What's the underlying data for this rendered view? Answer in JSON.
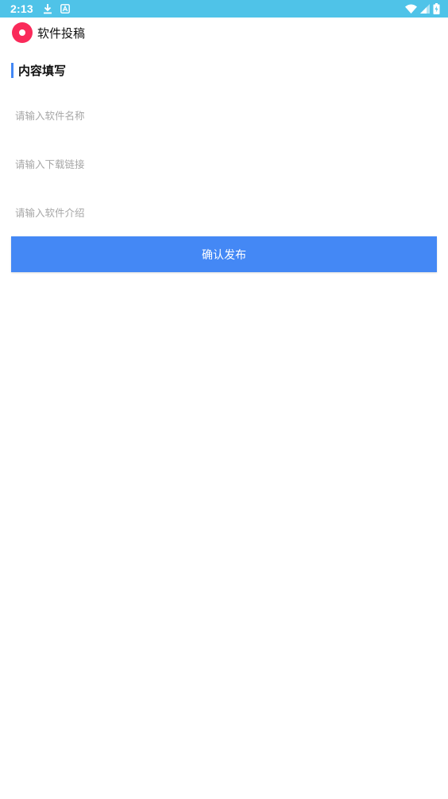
{
  "status_bar": {
    "time": "2:13",
    "left_icons": [
      "download-icon",
      "app-store-icon"
    ],
    "right_icons": [
      "wifi-icon",
      "signal-icon",
      "battery-charging-icon"
    ],
    "background_color": "#4fc3e8"
  },
  "header": {
    "title": "软件投稿",
    "logo_color": "#fa2a5a"
  },
  "section": {
    "title": "内容填写",
    "accent_color": "#4287f5"
  },
  "form": {
    "name_placeholder": "请输入软件名称",
    "link_placeholder": "请输入下载链接",
    "intro_placeholder": "请输入软件介绍",
    "name_value": "",
    "link_value": "",
    "intro_value": ""
  },
  "submit": {
    "label": "确认发布",
    "color": "#4488f5"
  }
}
